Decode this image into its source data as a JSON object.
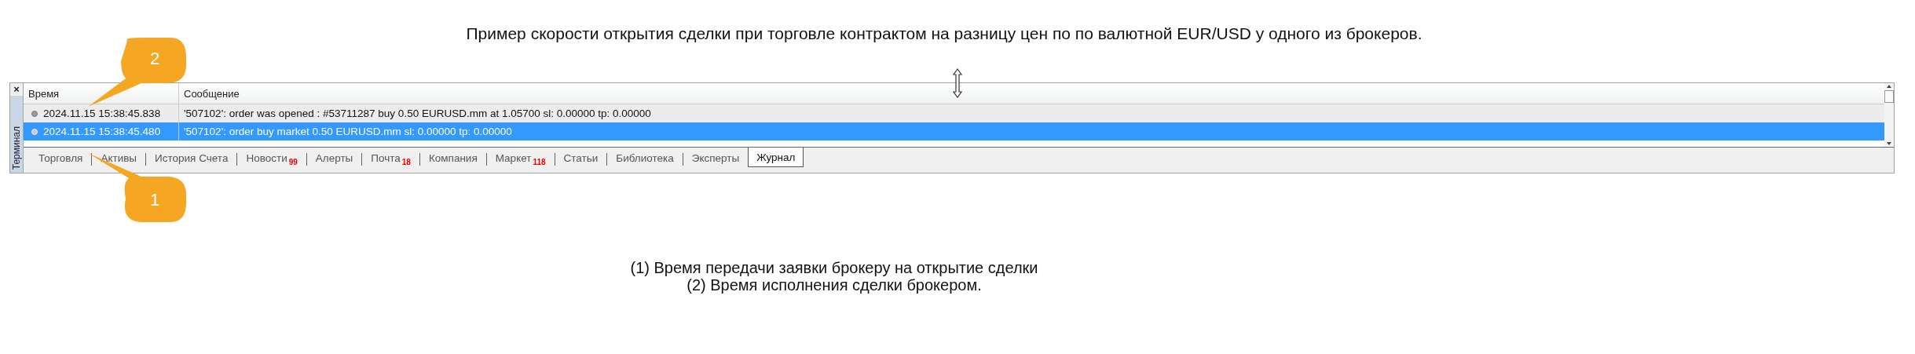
{
  "heading": "Пример скорости открытия сделки при торговле контрактом на разницу цен по по валютной EUR/USD у одного из брокеров.",
  "terminal": {
    "close": "×",
    "side_title": "Терминал",
    "columns": [
      "Время",
      "Сообщение"
    ],
    "rows": [
      {
        "time": "2024.11.15 15:38:45.838",
        "message": "'507102': order was opened : #53711287 buy 0.50 EURUSD.mm at 1.05700 sl: 0.00000 tp: 0.00000",
        "selected": false
      },
      {
        "time": "2024.11.15 15:38:45.480",
        "message": "'507102': order buy market 0.50 EURUSD.mm sl: 0.00000 tp: 0.00000",
        "selected": true
      }
    ],
    "tabs": [
      {
        "label": "Торговля",
        "selected": false
      },
      {
        "label": "Активы",
        "selected": false
      },
      {
        "label": "История Счета",
        "selected": false
      },
      {
        "label": "Новости",
        "badge": "99",
        "selected": false
      },
      {
        "label": "Алерты",
        "selected": false
      },
      {
        "label": "Почта",
        "badge": "18",
        "selected": false
      },
      {
        "label": "Компания",
        "selected": false
      },
      {
        "label": "Маркет",
        "badge": "118",
        "selected": false
      },
      {
        "label": "Статьи",
        "selected": false
      },
      {
        "label": "Библиотека",
        "selected": false
      },
      {
        "label": "Эксперты",
        "selected": false
      },
      {
        "label": "Журнал",
        "selected": true
      }
    ]
  },
  "callouts": [
    {
      "number": "2"
    },
    {
      "number": "1"
    }
  ],
  "notes": [
    "(1) Время передачи заявки брокеру на открытие сделки",
    "(2) Время исполнения сделки брокером."
  ]
}
